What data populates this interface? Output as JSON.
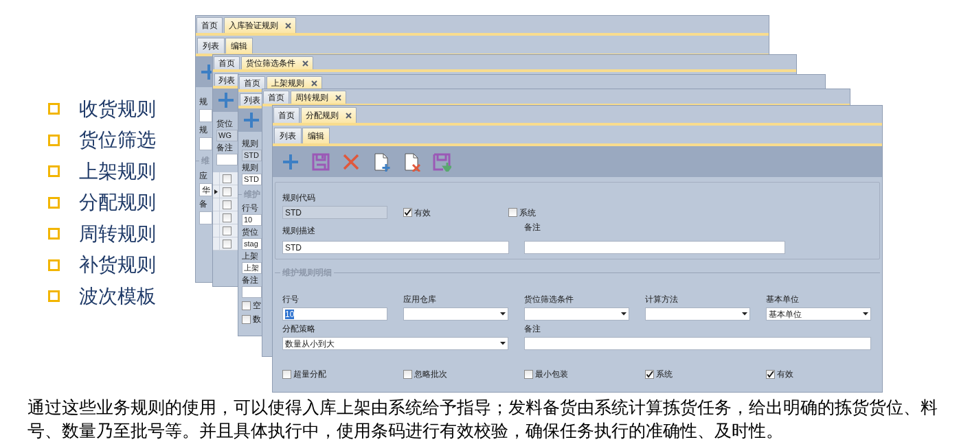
{
  "bullets": [
    "收货规则",
    "货位筛选",
    "上架规则",
    "分配规则",
    "周转规则",
    "补货规则",
    "波次模板"
  ],
  "windows": [
    {
      "tabs": [
        {
          "label": "首页",
          "selected": false,
          "closable": false
        },
        {
          "label": "入库验证规则",
          "selected": true,
          "closable": true
        }
      ],
      "subtabs": [
        {
          "label": "列表",
          "selected": false
        },
        {
          "label": "编辑",
          "selected": true
        }
      ],
      "strip": [
        {
          "kind": "label",
          "text": "规"
        },
        {
          "kind": "field",
          "readonly": false
        },
        {
          "kind": "label",
          "text": "规"
        },
        {
          "kind": "field",
          "readonly": false
        },
        {
          "kind": "legend",
          "text": "维"
        },
        {
          "kind": "label",
          "text": "应"
        },
        {
          "kind": "field",
          "readonly": false,
          "value": "华"
        },
        {
          "kind": "label",
          "text": "备"
        },
        {
          "kind": "field",
          "readonly": false
        }
      ]
    },
    {
      "tabs": [
        {
          "label": "首页",
          "selected": false,
          "closable": false
        },
        {
          "label": "货位筛选条件",
          "selected": true,
          "closable": true
        }
      ],
      "subtabs": [
        {
          "label": "列表",
          "selected": false
        }
      ],
      "strip": [
        {
          "kind": "label",
          "text": "货位"
        },
        {
          "kind": "field",
          "readonly": true,
          "value": "WG"
        },
        {
          "kind": "label",
          "text": "备注"
        },
        {
          "kind": "field",
          "readonly": false
        },
        {
          "kind": "grid",
          "rows": [
            {
              "current": false,
              "checked": false
            },
            {
              "current": true,
              "checked": false
            },
            {
              "current": false,
              "checked": false
            },
            {
              "current": false,
              "checked": false
            },
            {
              "current": false,
              "checked": false
            },
            {
              "current": false,
              "checked": false
            }
          ]
        }
      ]
    },
    {
      "tabs": [
        {
          "label": "首页",
          "selected": false,
          "closable": false
        },
        {
          "label": "上架规则",
          "selected": true,
          "closable": true
        }
      ],
      "subtabs": [
        {
          "label": "列表",
          "selected": false
        }
      ],
      "strip": [
        {
          "kind": "label",
          "text": "规则"
        },
        {
          "kind": "field",
          "readonly": true,
          "value": "STD"
        },
        {
          "kind": "label",
          "text": "规则"
        },
        {
          "kind": "field",
          "readonly": false,
          "value": "STD"
        },
        {
          "kind": "legend",
          "text": "维护"
        },
        {
          "kind": "label",
          "text": "行号"
        },
        {
          "kind": "field",
          "readonly": false,
          "value": "10"
        },
        {
          "kind": "label",
          "text": "货位"
        },
        {
          "kind": "field",
          "readonly": false,
          "value": "stag"
        },
        {
          "kind": "label",
          "text": "上架"
        },
        {
          "kind": "field",
          "readonly": false,
          "value": "上架"
        },
        {
          "kind": "label",
          "text": "备注"
        },
        {
          "kind": "field",
          "readonly": false
        },
        {
          "kind": "checkbox",
          "label": "空",
          "checked": false
        },
        {
          "kind": "checkbox",
          "label": "数",
          "checked": false
        }
      ]
    },
    {
      "tabs": [
        {
          "label": "首页",
          "selected": false,
          "closable": false
        },
        {
          "label": "周转规则",
          "selected": true,
          "closable": true
        }
      ]
    },
    {
      "tabs": [
        {
          "label": "首页",
          "selected": false,
          "closable": false
        },
        {
          "label": "分配规则",
          "selected": true,
          "closable": true
        }
      ],
      "subtabs": [
        {
          "label": "列表",
          "selected": false
        },
        {
          "label": "编辑",
          "selected": true
        }
      ]
    }
  ],
  "form": {
    "code_label": "规则代码",
    "code_value": "STD",
    "header_checks": [
      {
        "label": "有效",
        "checked": true
      },
      {
        "label": "系统",
        "checked": false
      }
    ],
    "desc_label": "规则描述",
    "desc_value": "STD",
    "remark_label": "备注",
    "legend": "维护规则明细",
    "row1": [
      {
        "label": "行号",
        "kind": "text",
        "value": "10",
        "text_selected": true
      },
      {
        "label": "应用仓库",
        "kind": "select"
      },
      {
        "label": "货位筛选条件",
        "kind": "select"
      },
      {
        "label": "计算方法",
        "kind": "select"
      },
      {
        "label": "基本单位",
        "kind": "select",
        "value": "基本单位"
      }
    ],
    "row2": [
      {
        "label": "分配策略",
        "kind": "select",
        "value": "数量从小到大"
      },
      {
        "label": "备注",
        "kind": "text"
      }
    ],
    "checks": [
      {
        "label": "超量分配",
        "checked": false
      },
      {
        "label": "忽略批次",
        "checked": false
      },
      {
        "label": "最小包装",
        "checked": false
      },
      {
        "label": "系统",
        "checked": true
      },
      {
        "label": "有效",
        "checked": true
      }
    ]
  },
  "caption": "通过这些业务规则的使用，可以使得入库上架由系统给予指导；发料备货由系统计算拣货任务，给出明确的拣货货位、料号、数量乃至批号等。并且具体执行中，使用条码进行有效校验，确保任务执行的准确性、及时性。"
}
